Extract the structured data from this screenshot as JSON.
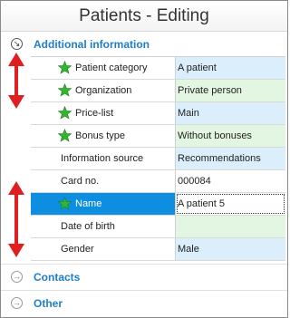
{
  "window": {
    "title": "Patients - Editing"
  },
  "groups": {
    "additional": {
      "label": "Additional information",
      "icon": "collapse-chevron-icon",
      "state": "expanded"
    },
    "contacts": {
      "label": "Contacts",
      "icon": "expand-chevron-icon",
      "state": "collapsed"
    },
    "other": {
      "label": "Other",
      "icon": "expand-chevron-icon",
      "state": "collapsed"
    }
  },
  "fields": [
    {
      "label": "Patient category",
      "value": "A patient",
      "required": true,
      "value_color": "blue"
    },
    {
      "label": "Organization",
      "value": "Private person",
      "required": true,
      "value_color": "green"
    },
    {
      "label": "Price-list",
      "value": "Main",
      "required": true,
      "value_color": "blue"
    },
    {
      "label": "Bonus type",
      "value": "Without bonuses",
      "required": true,
      "value_color": "green"
    },
    {
      "label": "Information source",
      "value": "Recommendations",
      "required": false,
      "value_color": "blue"
    },
    {
      "label": "Card no.",
      "value": "000084",
      "required": false,
      "value_color": "white"
    },
    {
      "label": "Name",
      "value": "A patient 5",
      "required": true,
      "value_color": "white",
      "selected": true
    },
    {
      "label": "Date of birth",
      "value": "",
      "required": false,
      "value_color": "green"
    },
    {
      "label": "Gender",
      "value": "Male",
      "required": false,
      "value_color": "blue"
    }
  ],
  "icons": {
    "required": "green-star-icon",
    "annotation": "red-double-arrow-icon"
  },
  "colors": {
    "accent": "#1f7ec6",
    "selection": "#0e8ee0",
    "required_star": "#33b530",
    "arrow": "#e02020"
  }
}
